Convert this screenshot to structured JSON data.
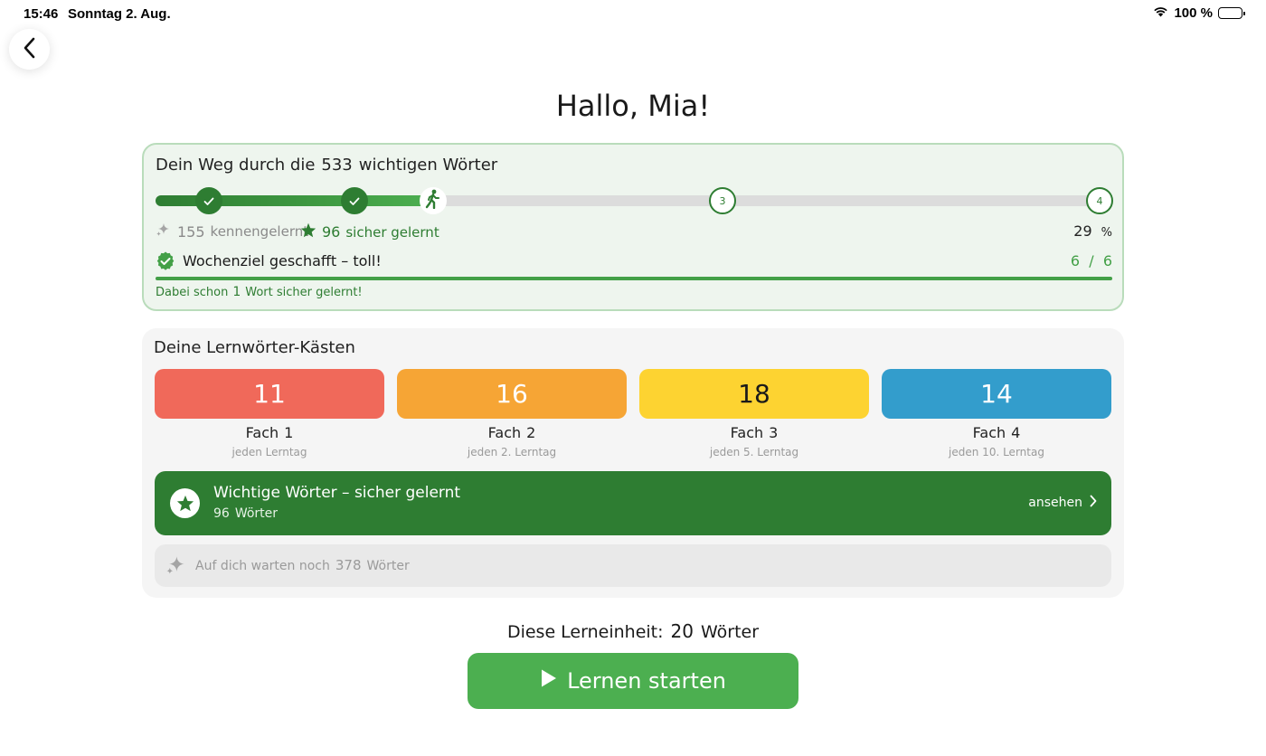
{
  "status_bar": {
    "time": "15:46",
    "date": "Sonntag 2. Aug.",
    "battery": "100 %"
  },
  "greeting": "Hallo, Mia!",
  "path": {
    "title_pre": "Dein Weg durch die",
    "word_total": "533",
    "title_post": "wichtigen Wörter",
    "progress_fraction": 0.29,
    "milestones": [
      {
        "state": "done",
        "label": ""
      },
      {
        "state": "done",
        "label": ""
      },
      {
        "state": "current",
        "label": ""
      },
      {
        "state": "open",
        "label": "3"
      },
      {
        "state": "open",
        "label": "4"
      }
    ],
    "known_count": "155",
    "known_label": "kennengelernt",
    "safe_count": "96",
    "safe_label": "sicher gelernt",
    "percent": "29",
    "percent_unit": "%"
  },
  "weekly_goal": {
    "label": "Wochenziel geschafft – toll!",
    "done": "6",
    "sep": "/",
    "total": "6",
    "fraction": 1.0,
    "note_pre": "Dabei schon",
    "note_count": "1",
    "note_post": "Wort sicher gelernt!"
  },
  "boxes": {
    "title": "Deine Lernwörter-Kästen",
    "items": [
      {
        "count": "11",
        "name": "Fach",
        "number": "1",
        "frequency": "jeden Lerntag",
        "color": "#f0695a",
        "text_color": "#ffffff"
      },
      {
        "count": "16",
        "name": "Fach",
        "number": "2",
        "frequency": "jeden  2. Lerntag",
        "color": "#f6a535",
        "text_color": "#ffffff"
      },
      {
        "count": "18",
        "name": "Fach",
        "number": "3",
        "frequency": "jeden  5. Lerntag",
        "color": "#fdd331",
        "text_color": "#1a1a1a"
      },
      {
        "count": "14",
        "name": "Fach",
        "number": "4",
        "frequency": "jeden  10. Lerntag",
        "color": "#339dcc",
        "text_color": "#ffffff"
      }
    ],
    "safe_banner": {
      "title": "Wichtige Wörter – sicher gelernt",
      "count": "96",
      "unit": "Wörter",
      "link": "ansehen"
    },
    "waiting": {
      "pre": "Auf dich warten noch",
      "count": "378",
      "post": "Wörter"
    }
  },
  "session": {
    "pre": "Diese Lerneinheit:",
    "count": "20",
    "post": "Wörter"
  },
  "start_button": {
    "label": "Lernen starten"
  },
  "colors": {
    "green_dark": "#2e7d32",
    "green": "#4caf50",
    "card_bg": "#eef5ee",
    "card_border": "#b9dcbb"
  }
}
